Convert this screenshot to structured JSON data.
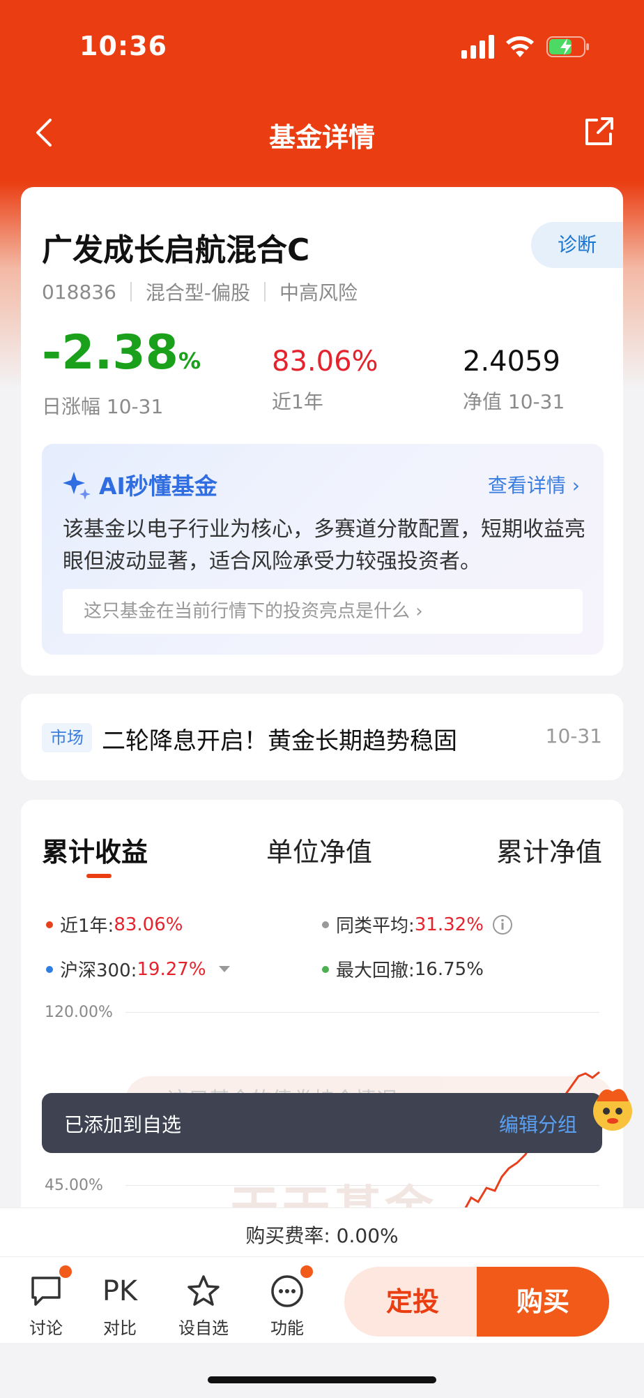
{
  "status_bar": {
    "time": "10:36"
  },
  "nav": {
    "title": "基金详情"
  },
  "fund": {
    "name": "广发成长启航混合C",
    "diagnose_label": "诊断",
    "code": "018836",
    "type": "混合型-偏股",
    "risk": "中高风险",
    "daily_change_value": "-2.38",
    "daily_change_unit": "%",
    "daily_change_label": "日涨幅 10-31",
    "one_year_value": "83.06%",
    "one_year_label": "近1年",
    "nav_value": "2.4059",
    "nav_label": "净值 10-31"
  },
  "ai": {
    "title": "AI秒懂基金",
    "more_label": "查看详情",
    "summary": "该基金以电子行业为核心，多赛道分散配置，短期收益亮眼但波动显著，适合风险承受力较强投资者。",
    "question": "这只基金在当前行情下的投资亮点是什么"
  },
  "news": {
    "tag": "市场",
    "title": "二轮降息开启！黄金长期趋势稳固",
    "date": "10-31"
  },
  "chart": {
    "tabs": [
      "累计收益",
      "单位净值",
      "累计净值"
    ],
    "active_tab": 0,
    "legend": {
      "item1_label": "近1年:",
      "item1_value": "83.06%",
      "item2_label": "同类平均:",
      "item2_value": "31.32%",
      "item3_label": "沪深300:",
      "item3_value": "19.27%",
      "item4_label": "最大回撤:",
      "item4_value": "16.75%"
    },
    "y_labels": [
      "120.00%",
      "45.00%"
    ],
    "watermark": "天天基金",
    "faded_banner": "这只基金的债券持仓情况",
    "colors": {
      "fund": "#e8401c",
      "category_avg": "#999999",
      "hs300": "#2f7de1",
      "drawdown": "#4caf50"
    }
  },
  "toast": {
    "text": "已添加到自选",
    "action": "编辑分组"
  },
  "fee": {
    "text": "购买费率: 0.00%"
  },
  "toolbar": {
    "discuss": "讨论",
    "compare_icon": "PK",
    "compare": "对比",
    "watchlist": "设自选",
    "functions": "功能",
    "auto_invest": "定投",
    "buy": "购买"
  }
}
